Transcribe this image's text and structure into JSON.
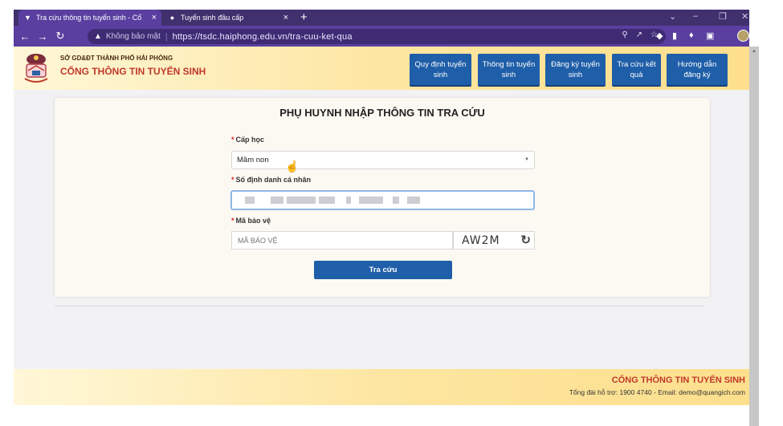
{
  "browser": {
    "tabs": [
      {
        "title": "Tra cứu thông tin tuyển sinh - Cổ",
        "icon": "hat-icon",
        "active": true
      },
      {
        "title": "Tuyển sinh đầu cấp",
        "icon": "globe-icon",
        "active": false
      }
    ],
    "security_label": "Không bảo mật",
    "url": "https://tsdc.haiphong.edu.vn/tra-cuu-ket-qua"
  },
  "header": {
    "org_line": "SỞ GD&ĐT THÀNH PHỐ HẢI PHÒNG",
    "portal_name": "CỔNG THÔNG TIN TUYỂN SINH",
    "nav": [
      "Quy định tuyển sinh",
      "Thông tin tuyển sinh",
      "Đăng ký tuyển sinh",
      "Tra cứu kết quả",
      "Hướng dẫn đăng ký"
    ]
  },
  "form": {
    "title": "PHỤ HUYNH NHẬP THÔNG TIN TRA CỨU",
    "level_label": "Cấp học",
    "level_value": "Mầm non",
    "id_label": "Số định danh cá nhân",
    "captcha_label": "Mã bảo vệ",
    "captcha_placeholder": "MÃ BẢO VỆ",
    "captcha_code": "AW2M",
    "submit_label": "Tra cứu"
  },
  "footer": {
    "title": "CỔNG THÔNG TIN TUYỂN SINH",
    "support": "Tổng đài hỗ trợ: 1900 4740 - Email: demo@quangich.com"
  },
  "colors": {
    "accent": "#1f5ea8",
    "brand_red": "#c0392b",
    "chrome": "#5a3fa0"
  }
}
